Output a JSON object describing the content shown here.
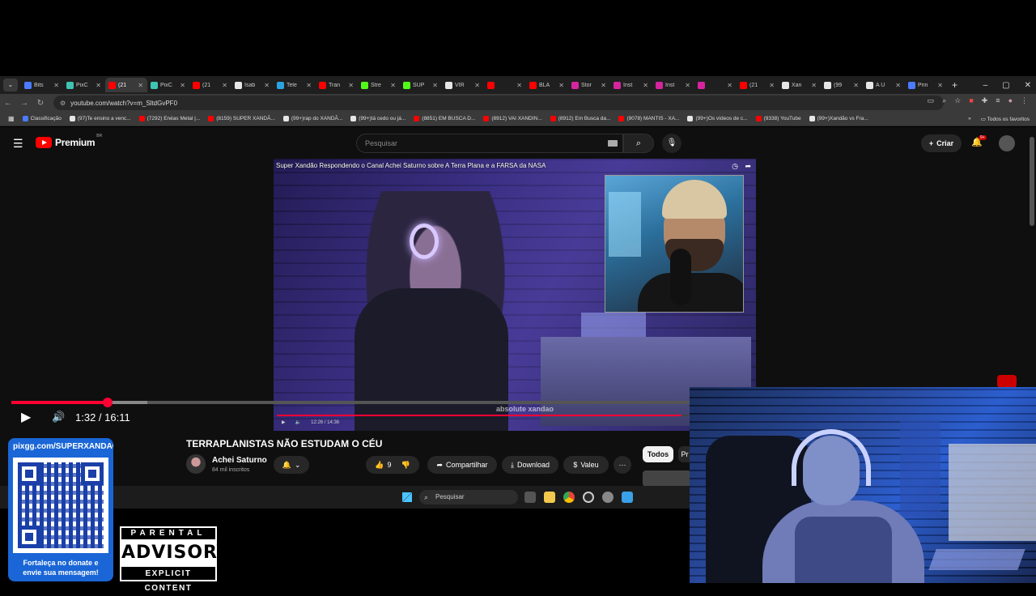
{
  "browser": {
    "tabs": [
      {
        "label": "Bits",
        "color": "#4b7bff"
      },
      {
        "label": "PixC",
        "color": "#3fc3b3"
      },
      {
        "label": "(21",
        "color": "#ff0000",
        "active": true
      },
      {
        "label": "PixC",
        "color": "#3fc3b3"
      },
      {
        "label": "(21",
        "color": "#ff0000"
      },
      {
        "label": "Isab",
        "color": "#e6e6e6"
      },
      {
        "label": "Tele",
        "color": "#2aa3e0"
      },
      {
        "label": "Tran",
        "color": "#ff0000"
      },
      {
        "label": "Stre",
        "color": "#53fc18"
      },
      {
        "label": "SUP",
        "color": "#53fc18"
      },
      {
        "label": "VIR",
        "color": "#e6e6e6"
      },
      {
        "label": "",
        "color": "#ff0000"
      },
      {
        "label": "BLA",
        "color": "#ff0000"
      },
      {
        "label": "Stor",
        "color": "#d6249f"
      },
      {
        "label": "Inst",
        "color": "#d6249f"
      },
      {
        "label": "Inst",
        "color": "#d6249f"
      },
      {
        "label": "",
        "color": "#d6249f"
      },
      {
        "label": "(21",
        "color": "#ff0000"
      },
      {
        "label": "Xan",
        "color": "#e6e6e6"
      },
      {
        "label": "(99",
        "color": "#e6e6e6"
      },
      {
        "label": "A Ú",
        "color": "#e6e6e6"
      },
      {
        "label": "Prin",
        "color": "#4b7bff"
      }
    ],
    "new_tab": "+",
    "window_controls": {
      "minimize": "–",
      "maximize": "▢",
      "close": "✕"
    },
    "address": "youtube.com/watch?v=m_SltdGvPF0",
    "bookmarks": [
      {
        "label": "Classificação",
        "color": "#4b7bff"
      },
      {
        "label": "(97)Te ensino a venc...",
        "color": "#e6e6e6"
      },
      {
        "label": "(7292) Enéas Metal |...",
        "color": "#ff0000"
      },
      {
        "label": "(8159) SUPER XANDÃ...",
        "color": "#ff0000"
      },
      {
        "label": "(99+)rap do XANDÃ...",
        "color": "#e6e6e6"
      },
      {
        "label": "(99+)tá cedo ou já...",
        "color": "#e6e6e6"
      },
      {
        "label": "(8851) EM BUSCA D...",
        "color": "#ff0000"
      },
      {
        "label": "(8912) VAI XANDIN...",
        "color": "#ff0000"
      },
      {
        "label": "(8912) Em Busca da...",
        "color": "#ff0000"
      },
      {
        "label": "(9078) MANTIS - XA...",
        "color": "#ff0000"
      },
      {
        "label": "(99+)Os vídeos de c...",
        "color": "#e6e6e6"
      },
      {
        "label": "(9338) YouTube",
        "color": "#ff0000"
      },
      {
        "label": "(99+)Xandão vs Fra...",
        "color": "#e6e6e6"
      }
    ],
    "all_bookmarks": "Todos os favoritos"
  },
  "youtube": {
    "logo_text": "Premium",
    "logo_region": "BR",
    "search_placeholder": "Pesquisar",
    "create_label": "Criar",
    "notif_count": "9+",
    "embedded_video": {
      "title": "Super Xandão Respondendo o Canal Achei Saturno sobre A Terra Plana e a FARSA da NASA",
      "time": "12:26 / 14:36",
      "watermark": "absolute xandao",
      "progress": 0.85
    },
    "player": {
      "time": "1:32 / 16:11",
      "progress": 0.142,
      "buffered": 0.2
    },
    "video_title": "TERRAPLANISTAS NÃO ESTUDAM O CÉU",
    "channel_name": "Achei Saturno",
    "channel_subs": "84 mil inscritos",
    "likes": "9",
    "share_label": "Compartilhar",
    "download_label": "Download",
    "thanks_label": "Valeu",
    "more_label": "···",
    "chip_all": "Todos",
    "chip_next": "Pr"
  },
  "taskbar": {
    "search_label": "Pesquisar"
  },
  "overlay": {
    "donate_url": "pixgg.com/SUPERXANDAO",
    "donate_msg_line1": "Fortaleça no donate e",
    "donate_msg_line2": "envie sua mensagem!",
    "advisory_top": "PARENTAL",
    "advisory_mid": "ADVISORY",
    "advisory_bottom": "EXPLICIT CONTENT"
  }
}
